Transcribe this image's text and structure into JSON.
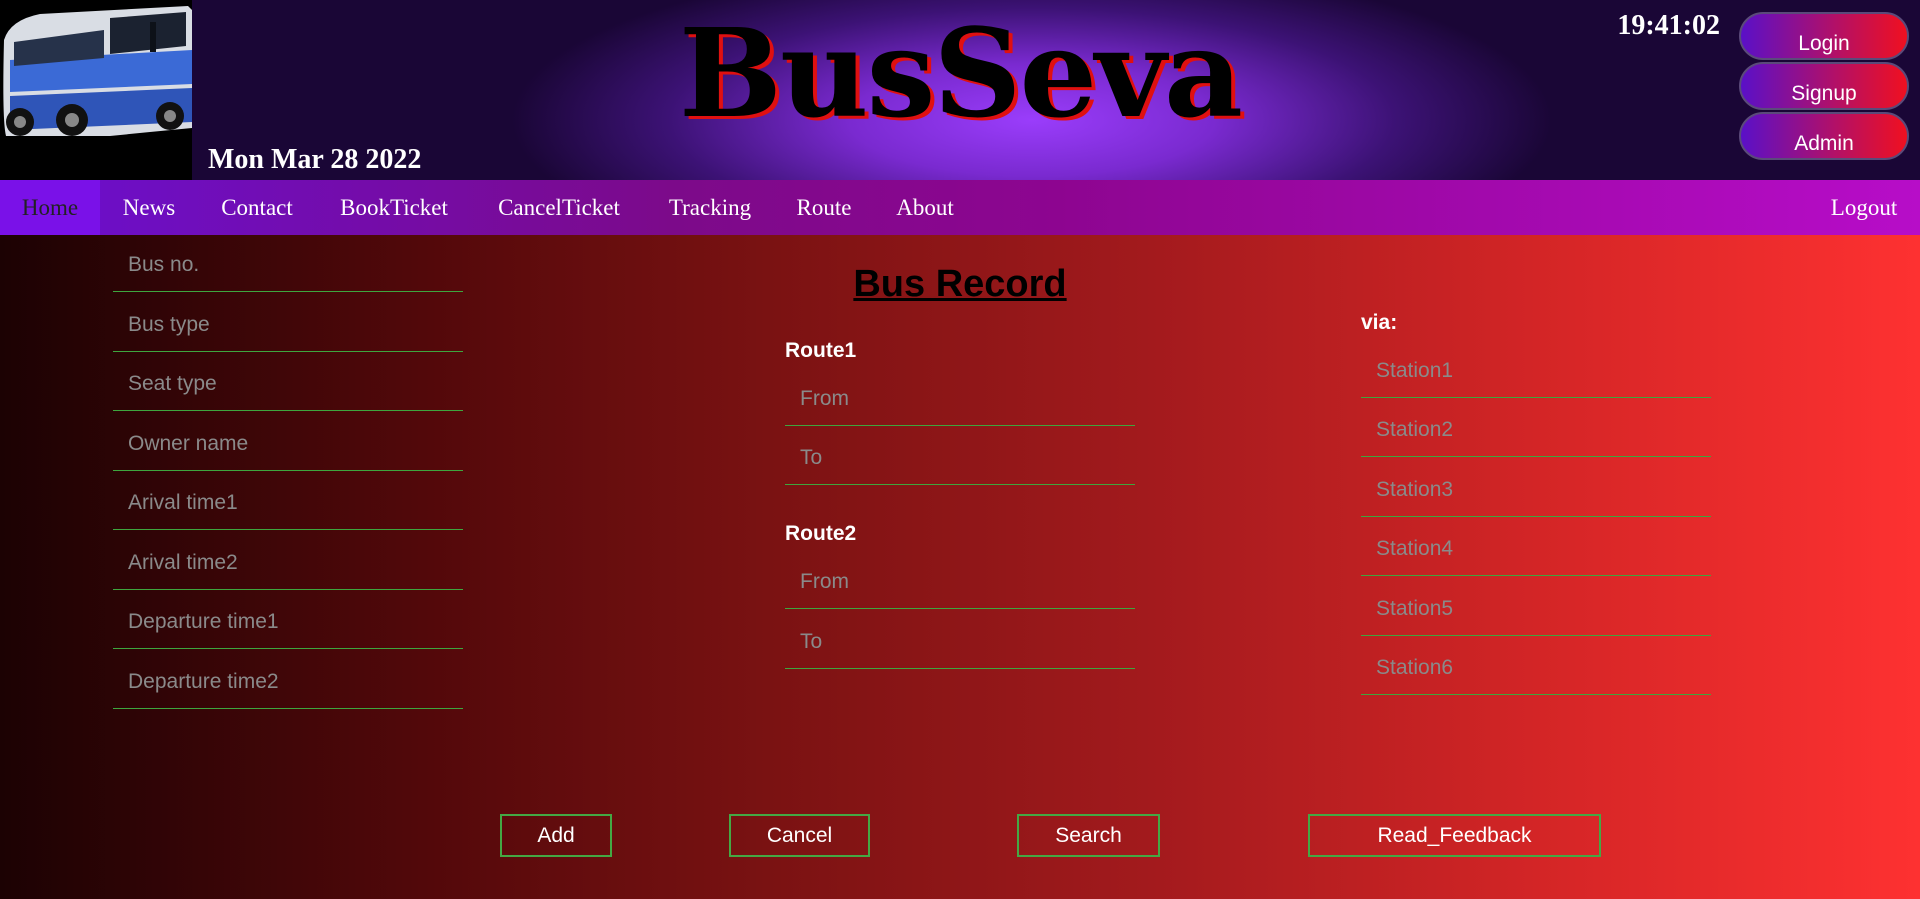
{
  "header": {
    "brand": "BusSeva",
    "date": "Mon Mar 28 2022",
    "clock": "19:41:02",
    "auth": {
      "login": "Login",
      "signup": "Signup",
      "admin": "Admin"
    },
    "logo_icon": "bus-icon"
  },
  "nav": {
    "items": [
      "Home",
      "News",
      "Contact",
      "BookTicket",
      "CancelTicket",
      "Tracking",
      "Route",
      "About"
    ],
    "active": "Home",
    "logout": "Logout"
  },
  "form": {
    "title": "Bus Record",
    "left_fields": {
      "bus_no": "Bus no.",
      "bus_type": "Bus type",
      "seat_type": "Seat type",
      "owner_name": "Owner name",
      "arival_time1": "Arival time1",
      "arival_time2": "Arival time2",
      "departure_time1": "Departure time1",
      "departure_time2": "Departure time2"
    },
    "route1": {
      "label": "Route1",
      "from": "From",
      "to": "To"
    },
    "route2": {
      "label": "Route2",
      "from": "From",
      "to": "To"
    },
    "via": {
      "label": "via:",
      "stations": [
        "Station1",
        "Station2",
        "Station3",
        "Station4",
        "Station5",
        "Station6"
      ]
    },
    "buttons": {
      "add": "Add",
      "cancel": "Cancel",
      "search": "Search",
      "read_feedback": "Read_Feedback"
    }
  },
  "colors": {
    "accent_green": "#3ea63e",
    "nav_active": "#7a11e8",
    "brand_shadow": "#e01010"
  }
}
